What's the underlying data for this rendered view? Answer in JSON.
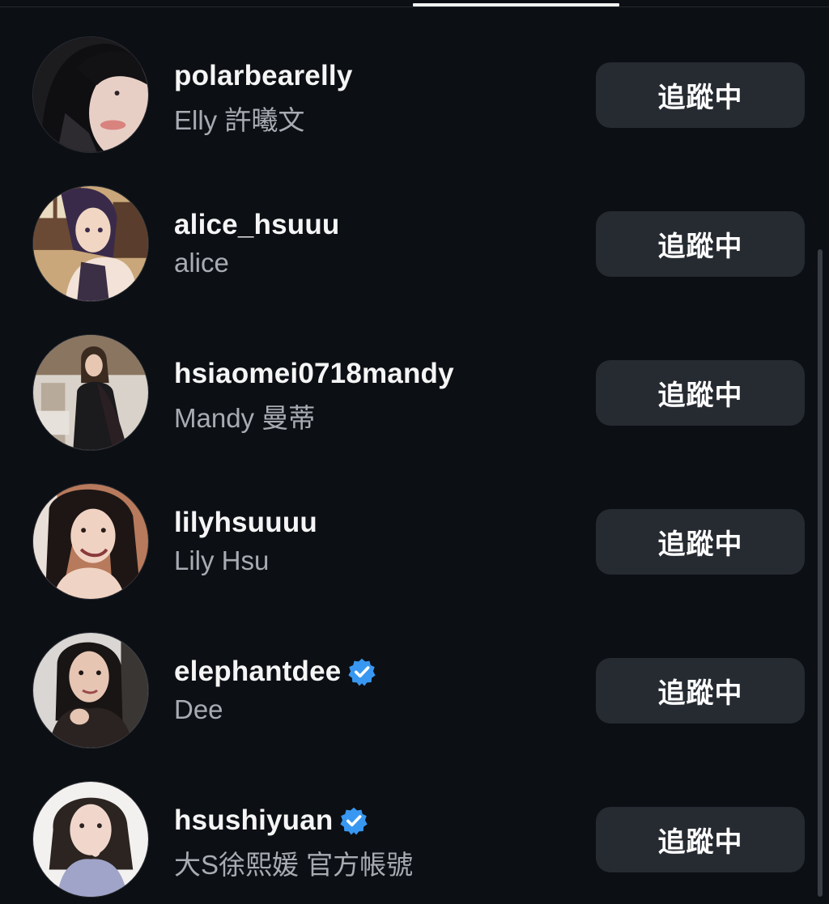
{
  "users": [
    {
      "username": "polarbearelly",
      "display_name": "Elly 許曦文",
      "verified": false,
      "button_label": "追蹤中",
      "avatar": "profile-photo"
    },
    {
      "username": "alice_hsuuu",
      "display_name": "alice",
      "verified": false,
      "button_label": "追蹤中",
      "avatar": "anime-illustration"
    },
    {
      "username": "hsiaomei0718mandy",
      "display_name": "Mandy 曼蒂",
      "verified": false,
      "button_label": "追蹤中",
      "avatar": "profile-photo"
    },
    {
      "username": "lilyhsuuuu",
      "display_name": "Lily Hsu",
      "verified": false,
      "button_label": "追蹤中",
      "avatar": "profile-photo"
    },
    {
      "username": "elephantdee",
      "display_name": "Dee",
      "verified": true,
      "button_label": "追蹤中",
      "avatar": "profile-photo"
    },
    {
      "username": "hsushiyuan",
      "display_name": "大S徐熙媛  官方帳號",
      "verified": true,
      "button_label": "追蹤中",
      "avatar": "profile-photo"
    }
  ],
  "colors": {
    "background": "#0c0f14",
    "button_bg": "#262a31",
    "secondary_text": "#a8abb2",
    "verified_blue": "#3897f0"
  }
}
